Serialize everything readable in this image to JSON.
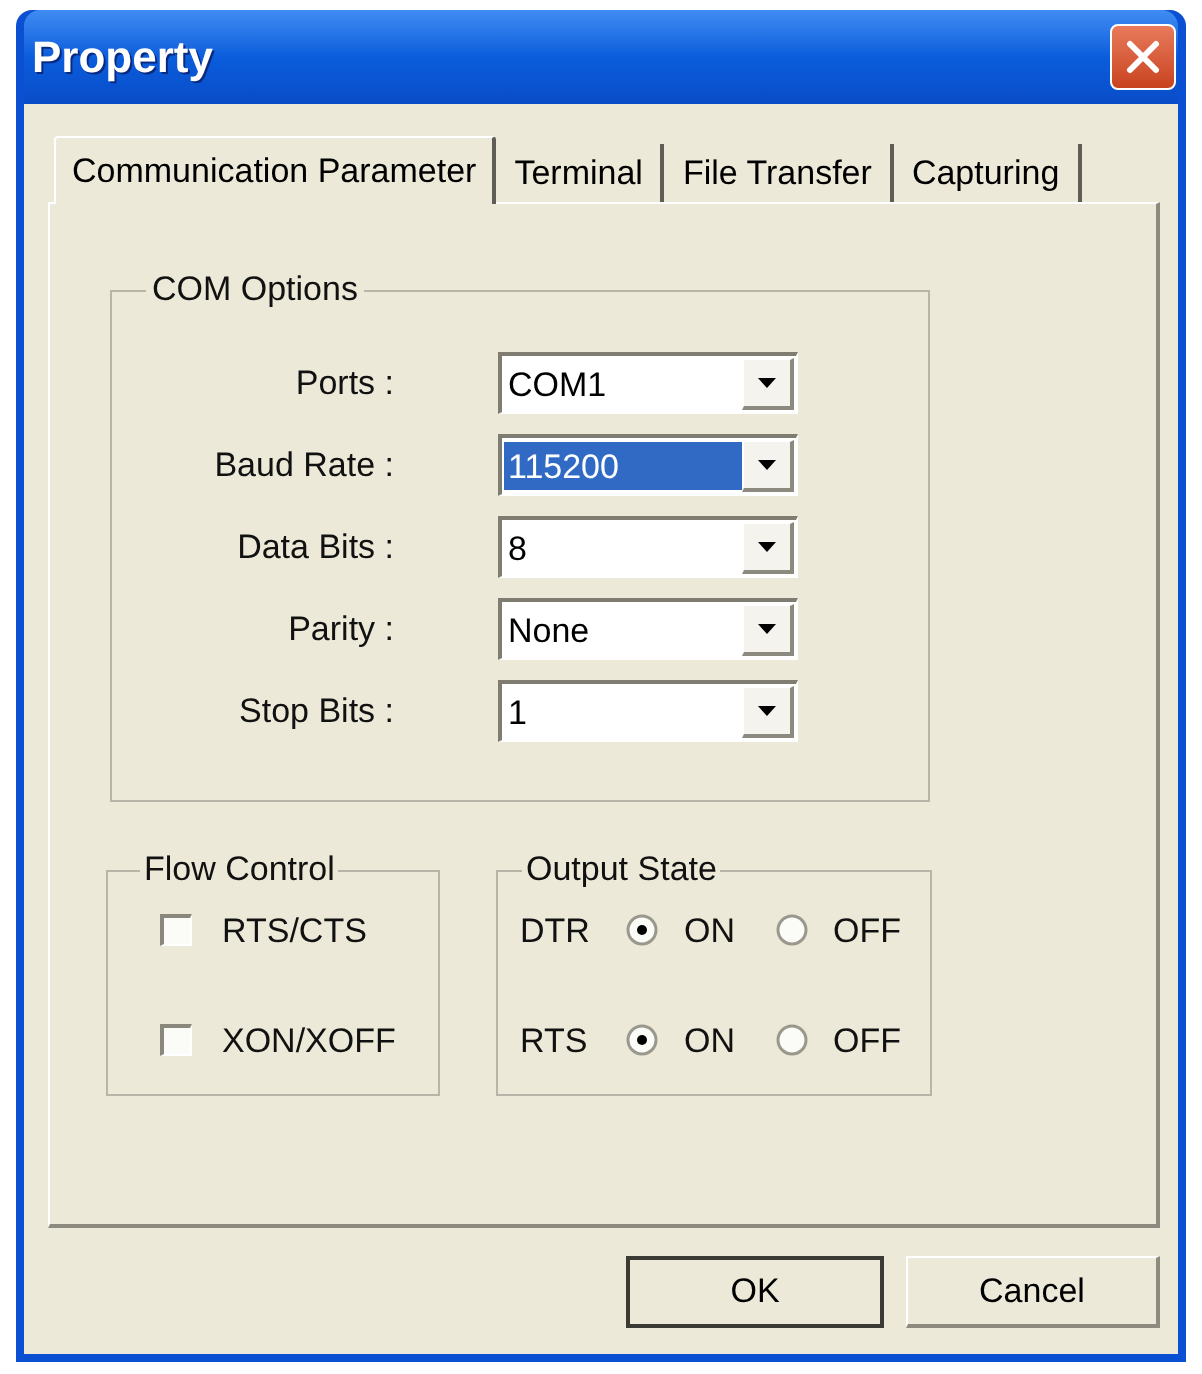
{
  "window": {
    "title": "Property"
  },
  "tabs": [
    {
      "label": "Communication Parameter",
      "selected": true
    },
    {
      "label": "Terminal",
      "selected": false
    },
    {
      "label": "File Transfer",
      "selected": false
    },
    {
      "label": "Capturing",
      "selected": false
    }
  ],
  "com_options": {
    "title": "COM Options",
    "fields": [
      {
        "label": "Ports :",
        "value": "COM1",
        "highlighted": false
      },
      {
        "label": "Baud Rate :",
        "value": "115200",
        "highlighted": true
      },
      {
        "label": "Data Bits :",
        "value": "8",
        "highlighted": false
      },
      {
        "label": "Parity :",
        "value": "None",
        "highlighted": false
      },
      {
        "label": "Stop Bits :",
        "value": "1",
        "highlighted": false
      }
    ]
  },
  "flow_control": {
    "title": "Flow Control",
    "options": [
      {
        "label": "RTS/CTS",
        "checked": false
      },
      {
        "label": "XON/XOFF",
        "checked": false
      }
    ]
  },
  "output_state": {
    "title": "Output State",
    "rows": [
      {
        "label": "DTR",
        "options": [
          {
            "label": "ON",
            "selected": true
          },
          {
            "label": "OFF",
            "selected": false
          }
        ]
      },
      {
        "label": "RTS",
        "options": [
          {
            "label": "ON",
            "selected": true
          },
          {
            "label": "OFF",
            "selected": false
          }
        ]
      }
    ]
  },
  "buttons": [
    {
      "label": "OK",
      "default": true
    },
    {
      "label": "Cancel",
      "default": false
    }
  ]
}
